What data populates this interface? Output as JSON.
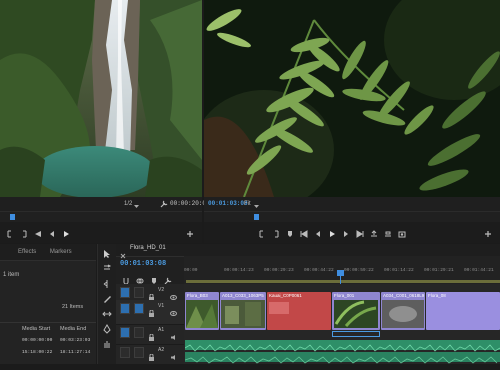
{
  "colors": {
    "accent": "#3f8ee0",
    "video_clip": "#8f86d0",
    "audio_track": "#33a477",
    "red_clip": "#c24848",
    "panel": "#232323"
  },
  "source_monitor": {
    "zoom": "1/2",
    "timecode": "00:00:20:01"
  },
  "program_monitor": {
    "timecode": "00:01:03:08",
    "fit": "Fit"
  },
  "project_panel": {
    "tabs": [
      "Effects",
      "Markers"
    ],
    "row_label": "1 item",
    "item_count": "21 Items",
    "columns": [
      "Media Start",
      "Media End"
    ],
    "rows": [
      {
        "start": "00:00:00:00",
        "end": "00:03:23:03"
      },
      {
        "start": "15:18:00:22",
        "end": "18:11:27:14"
      }
    ]
  },
  "timeline": {
    "sequence_name": "Flora_HD_01",
    "timecode": "00:01:03:08",
    "ruler": [
      "00:00",
      "00:00:14:23",
      "00:00:29:23",
      "00:00:44:22",
      "00:00:59:22",
      "00:01:14:22",
      "00:01:29:21",
      "00:01:44:21",
      "00:01:5"
    ],
    "tracks": [
      "V2",
      "V1",
      "A1",
      "A2"
    ],
    "clips": [
      {
        "label": "Flora_B03"
      },
      {
        "label": "A013_C033_1063P5"
      },
      {
        "label": "Kauai_C0P0061"
      },
      {
        "label": "Flora_001"
      },
      {
        "label": "A034_C001_0618L9"
      },
      {
        "label": "Flora_08"
      }
    ]
  }
}
